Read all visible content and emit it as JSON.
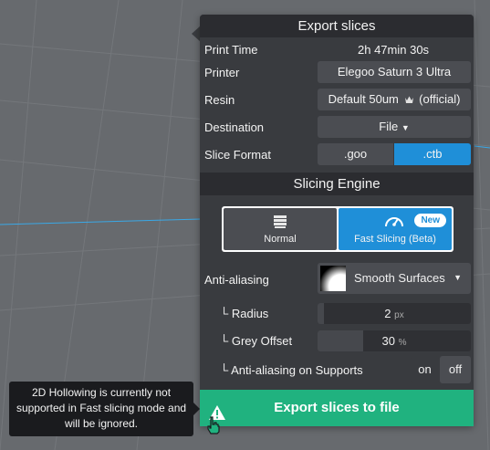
{
  "panel": {
    "title": "Export slices",
    "print_time": {
      "label": "Print Time",
      "value": "2h 47min 30s"
    },
    "printer": {
      "label": "Printer",
      "value": "Elegoo Saturn 3 Ultra"
    },
    "resin": {
      "label": "Resin",
      "value_prefix": "Default 50um",
      "value_suffix": "(official)",
      "icon": "crown-icon"
    },
    "destination": {
      "label": "Destination",
      "value": "File"
    },
    "slice_format": {
      "label": "Slice Format",
      "options": [
        ".goo",
        ".ctb"
      ],
      "selected": ".ctb"
    }
  },
  "engine": {
    "title": "Slicing Engine",
    "normal_label": "Normal",
    "fast_label": "Fast Slicing (Beta)",
    "new_badge": "New",
    "selected": "Fast Slicing (Beta)"
  },
  "anti_aliasing": {
    "label": "Anti-aliasing",
    "value": "Smooth Surfaces",
    "radius": {
      "label": "Radius",
      "value": "2",
      "unit": "px",
      "fill_fraction": 0.03
    },
    "grey_offset": {
      "label": "Grey Offset",
      "value": "30",
      "unit": "%",
      "fill_fraction": 0.3
    },
    "supports": {
      "label": "Anti-aliasing on Supports",
      "on_label": "on",
      "off_label": "off",
      "selected": "off"
    }
  },
  "export_button": {
    "label": "Export slices to file"
  },
  "tooltip": {
    "text": "2D Hollowing is currently not supported in Fast slicing mode and will be ignored."
  },
  "colors": {
    "accent": "#1f8fd8",
    "export": "#20b27f",
    "panel": "#393b3f",
    "header": "#2b2c30"
  }
}
